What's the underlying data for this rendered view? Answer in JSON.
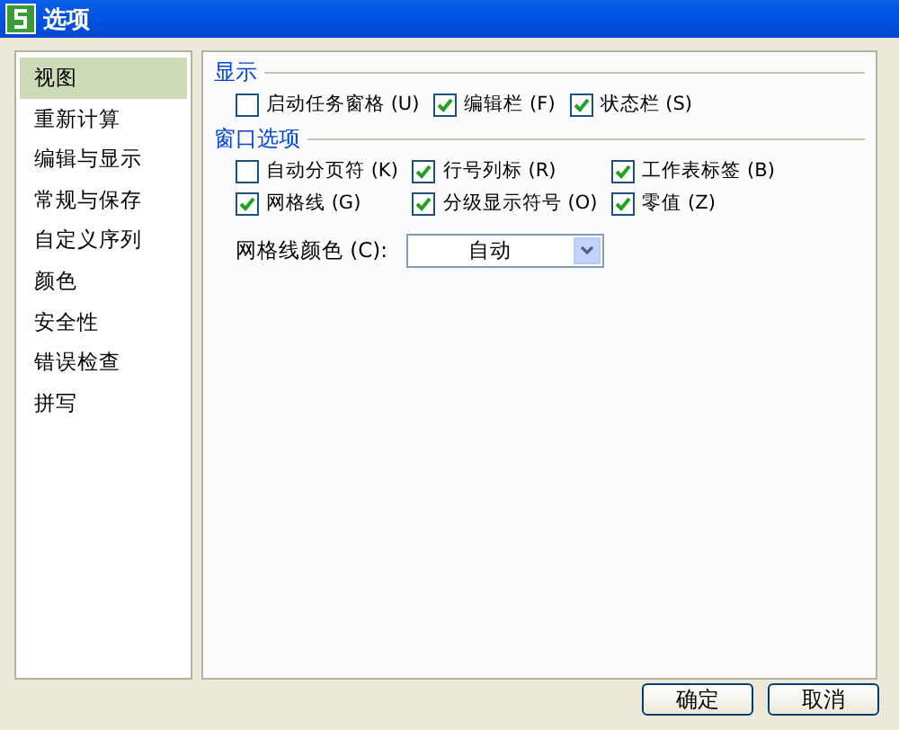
{
  "window": {
    "title": "选项"
  },
  "sidebar": {
    "items": [
      {
        "label": "视图",
        "selected": true
      },
      {
        "label": "重新计算",
        "selected": false
      },
      {
        "label": "编辑与显示",
        "selected": false
      },
      {
        "label": "常规与保存",
        "selected": false
      },
      {
        "label": "自定义序列",
        "selected": false
      },
      {
        "label": "颜色",
        "selected": false
      },
      {
        "label": "安全性",
        "selected": false
      },
      {
        "label": "错误检查",
        "selected": false
      },
      {
        "label": "拼写",
        "selected": false
      }
    ]
  },
  "sections": [
    {
      "title": "显示",
      "options": [
        {
          "label": "启动任务窗格 (U)",
          "checked": false
        },
        {
          "label": "编辑栏 (F)",
          "checked": true
        },
        {
          "label": "状态栏 (S)",
          "checked": true
        }
      ]
    },
    {
      "title": "窗口选项",
      "options": [
        {
          "label": "自动分页符 (K)",
          "checked": false
        },
        {
          "label": "行号列标 (R)",
          "checked": true
        },
        {
          "label": "工作表标签 (B)",
          "checked": true
        },
        {
          "label": "网格线 (G)",
          "checked": true
        },
        {
          "label": "分级显示符号 (O)",
          "checked": true
        },
        {
          "label": "零值 (Z)",
          "checked": true
        }
      ],
      "gridline_color": {
        "label": "网格线颜色 (C):",
        "value": "自动"
      }
    }
  ],
  "buttons": [
    "确定",
    "取消"
  ]
}
